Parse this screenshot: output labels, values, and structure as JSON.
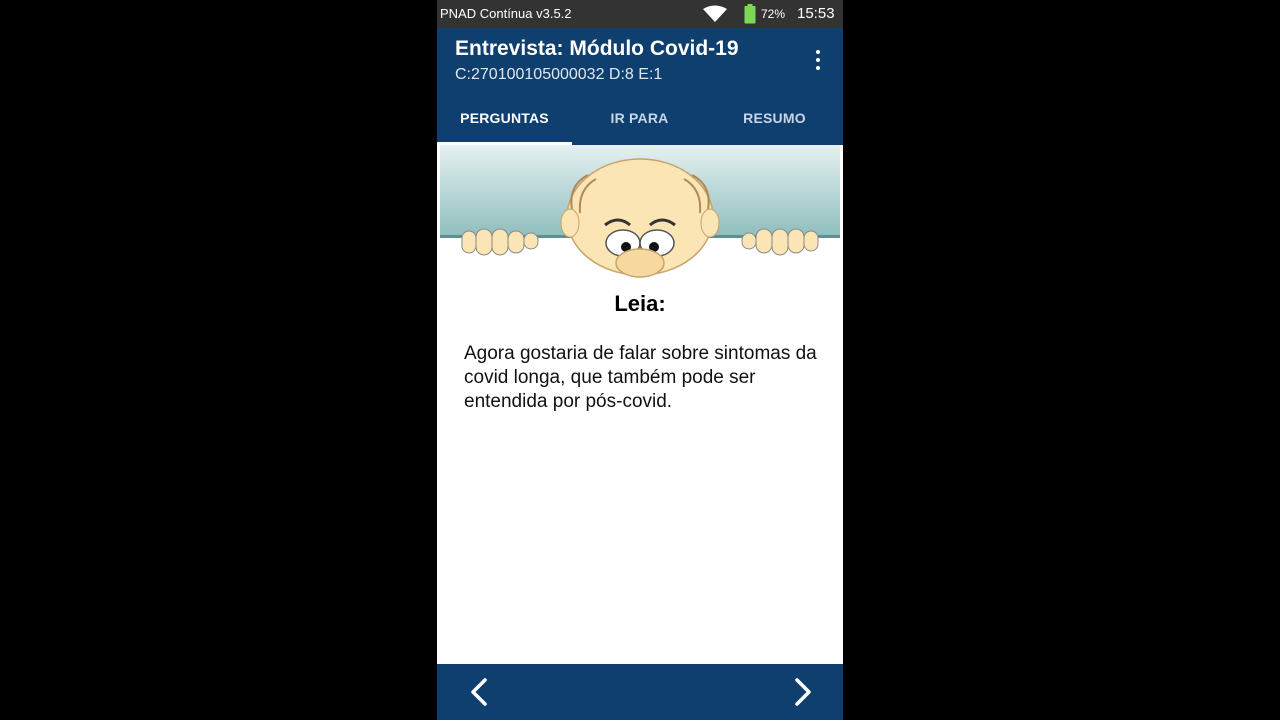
{
  "status_bar": {
    "app_label": "PNAD Contínua v3.5.2",
    "battery_percent": "72%",
    "time": "15:53",
    "icons": [
      "wifi-icon",
      "battery-icon"
    ]
  },
  "app_bar": {
    "title": "Entrevista: Módulo Covid-19",
    "subtitle": "C:270100105000032 D:8 E:1",
    "menu_icon": "more-vertical-icon"
  },
  "tabs": [
    {
      "label": "PERGUNTAS",
      "active": true
    },
    {
      "label": "IR PARA",
      "active": false
    },
    {
      "label": "RESUMO",
      "active": false
    }
  ],
  "content": {
    "heading": "Leia:",
    "text": "Agora gostaria de falar sobre sintomas da covid longa, que também pode ser entendida por pós-covid.",
    "illustration": "peeking-cartoon-character"
  },
  "bottom_bar": {
    "prev_icon": "chevron-left-icon",
    "next_icon": "chevron-right-icon"
  },
  "colors": {
    "primary": "#0f3f6e",
    "status_bar": "#333333",
    "battery": "#7ed957",
    "background": "#000000"
  }
}
